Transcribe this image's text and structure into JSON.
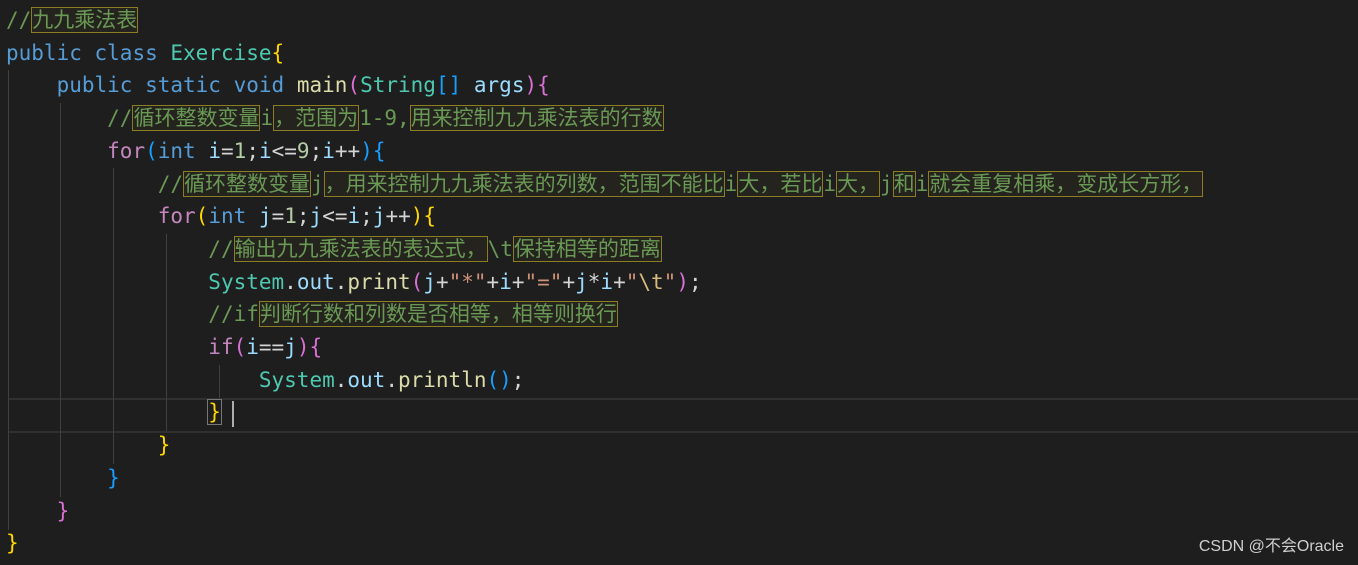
{
  "editor": {
    "lines": [
      {
        "segs": [
          [
            "cm",
            "//"
          ],
          [
            "cm hl",
            "九九乘法表"
          ]
        ]
      },
      {
        "segs": [
          [
            "kw",
            "public"
          ],
          [
            "op",
            " "
          ],
          [
            "kw",
            "class"
          ],
          [
            "op",
            " "
          ],
          [
            "type",
            "Exercise"
          ],
          [
            "b1",
            "{"
          ]
        ]
      },
      {
        "segs": [
          [
            "op",
            "    "
          ],
          [
            "kw",
            "public"
          ],
          [
            "op",
            " "
          ],
          [
            "kw",
            "static"
          ],
          [
            "op",
            " "
          ],
          [
            "kw",
            "void"
          ],
          [
            "op",
            " "
          ],
          [
            "fn",
            "main"
          ],
          [
            "b2",
            "("
          ],
          [
            "type",
            "String"
          ],
          [
            "b3",
            "[]"
          ],
          [
            "op",
            " "
          ],
          [
            "var",
            "args"
          ],
          [
            "b2",
            ")"
          ],
          [
            "b2",
            "{"
          ]
        ]
      },
      {
        "segs": [
          [
            "op",
            "        "
          ],
          [
            "cm",
            "//"
          ],
          [
            "cm hl",
            "循环整数变量"
          ],
          [
            "cm",
            "i"
          ],
          [
            "cm hl",
            "，范围为"
          ],
          [
            "cm",
            "1-9,"
          ],
          [
            "cm hl",
            "用来控制九九乘法表的行数"
          ]
        ]
      },
      {
        "segs": [
          [
            "op",
            "        "
          ],
          [
            "ctl",
            "for"
          ],
          [
            "b3",
            "("
          ],
          [
            "kw",
            "int"
          ],
          [
            "op",
            " "
          ],
          [
            "var",
            "i"
          ],
          [
            "op",
            "="
          ],
          [
            "num",
            "1"
          ],
          [
            "op",
            ";"
          ],
          [
            "var",
            "i"
          ],
          [
            "op",
            "<="
          ],
          [
            "num",
            "9"
          ],
          [
            "op",
            ";"
          ],
          [
            "var",
            "i"
          ],
          [
            "op",
            "++"
          ],
          [
            "b3",
            ")"
          ],
          [
            "b3",
            "{"
          ]
        ]
      },
      {
        "segs": [
          [
            "op",
            "            "
          ],
          [
            "cm",
            "//"
          ],
          [
            "cm hl",
            "循环整数变量"
          ],
          [
            "cm",
            "j"
          ],
          [
            "cm hl",
            "，用来控制九九乘法表的列数，范围不能比"
          ],
          [
            "cm",
            "i"
          ],
          [
            "cm hl",
            "大，若比"
          ],
          [
            "cm",
            "i"
          ],
          [
            "cm hl",
            "大，"
          ],
          [
            "cm",
            "j"
          ],
          [
            "cm hl",
            "和"
          ],
          [
            "cm",
            "i"
          ],
          [
            "cm hl",
            "就会重复相乘，变成长方形，"
          ]
        ]
      },
      {
        "segs": [
          [
            "op",
            "            "
          ],
          [
            "ctl",
            "for"
          ],
          [
            "b1",
            "("
          ],
          [
            "kw",
            "int"
          ],
          [
            "op",
            " "
          ],
          [
            "var",
            "j"
          ],
          [
            "op",
            "="
          ],
          [
            "num",
            "1"
          ],
          [
            "op",
            ";"
          ],
          [
            "var",
            "j"
          ],
          [
            "op",
            "<="
          ],
          [
            "var",
            "i"
          ],
          [
            "op",
            ";"
          ],
          [
            "var",
            "j"
          ],
          [
            "op",
            "++"
          ],
          [
            "b1",
            ")"
          ],
          [
            "b1",
            "{"
          ]
        ]
      },
      {
        "segs": [
          [
            "op",
            "                "
          ],
          [
            "cm",
            "//"
          ],
          [
            "cm hl",
            "输出九九乘法表的表达式，"
          ],
          [
            "cm",
            "\\t"
          ],
          [
            "cm hl",
            "保持相等的距离"
          ]
        ]
      },
      {
        "segs": [
          [
            "op",
            "                "
          ],
          [
            "type",
            "System"
          ],
          [
            "op",
            "."
          ],
          [
            "var",
            "out"
          ],
          [
            "op",
            "."
          ],
          [
            "fn",
            "print"
          ],
          [
            "b2",
            "("
          ],
          [
            "var",
            "j"
          ],
          [
            "op",
            "+"
          ],
          [
            "str",
            "\"*\""
          ],
          [
            "op",
            "+"
          ],
          [
            "var",
            "i"
          ],
          [
            "op",
            "+"
          ],
          [
            "str",
            "\"=\""
          ],
          [
            "op",
            "+"
          ],
          [
            "var",
            "j"
          ],
          [
            "op",
            "*"
          ],
          [
            "var",
            "i"
          ],
          [
            "op",
            "+"
          ],
          [
            "str",
            "\""
          ],
          [
            "esc",
            "\\t"
          ],
          [
            "str",
            "\""
          ],
          [
            "b2",
            ")"
          ],
          [
            "op",
            ";"
          ]
        ]
      },
      {
        "segs": [
          [
            "op",
            "                "
          ],
          [
            "cm",
            "//if"
          ],
          [
            "cm hl",
            "判断行数和列数是否相等，相等则换行"
          ]
        ]
      },
      {
        "segs": [
          [
            "op",
            "                "
          ],
          [
            "ctl",
            "if"
          ],
          [
            "b2",
            "("
          ],
          [
            "var",
            "i"
          ],
          [
            "op",
            "=="
          ],
          [
            "var",
            "j"
          ],
          [
            "b2",
            ")"
          ],
          [
            "b2",
            "{"
          ]
        ]
      },
      {
        "segs": [
          [
            "op",
            "                    "
          ],
          [
            "type",
            "System"
          ],
          [
            "op",
            "."
          ],
          [
            "var",
            "out"
          ],
          [
            "op",
            "."
          ],
          [
            "fn",
            "println"
          ],
          [
            "b3",
            "()"
          ],
          [
            "op",
            ";"
          ]
        ]
      },
      {
        "segs": [
          [
            "op",
            "                "
          ],
          [
            "b1box",
            "}"
          ]
        ]
      },
      {
        "segs": [
          [
            "op",
            "            "
          ],
          [
            "b1",
            "}"
          ]
        ]
      },
      {
        "segs": [
          [
            "op",
            "        "
          ],
          [
            "b3",
            "}"
          ]
        ]
      },
      {
        "segs": [
          [
            "op",
            "    "
          ],
          [
            "b2",
            "}"
          ]
        ]
      },
      {
        "segs": [
          [
            "b1",
            "}"
          ]
        ]
      }
    ]
  },
  "watermark": "CSDN @不会Oracle"
}
